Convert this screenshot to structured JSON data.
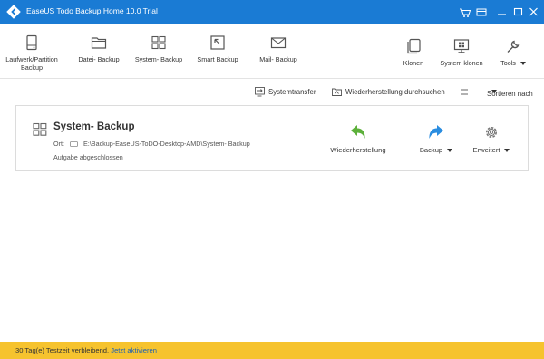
{
  "window": {
    "title": "EaseUS Todo Backup Home 10.0 Trial"
  },
  "toolbar": {
    "items": [
      {
        "label": "Laufwerk/Partition Backup",
        "icon": "disk-icon"
      },
      {
        "label": "Datei- Backup",
        "icon": "folder-icon"
      },
      {
        "label": "System- Backup",
        "icon": "windows-icon"
      },
      {
        "label": "Smart Backup",
        "icon": "smart-icon"
      },
      {
        "label": "Mail- Backup",
        "icon": "mail-icon"
      }
    ],
    "right_items": [
      {
        "label": "Klonen",
        "icon": "clone-icon"
      },
      {
        "label": "System klonen",
        "icon": "system-clone-icon"
      },
      {
        "label": "Tools",
        "icon": "wrench-icon"
      }
    ]
  },
  "actions": {
    "systemtransfer": "Systemtransfer",
    "restore_search": "Wiederherstellung durchsuchen",
    "sort": "Sortieren nach"
  },
  "task": {
    "title": "System- Backup",
    "location_label": "Ort:",
    "location_path": "E:\\Backup-EaseUS-ToDO-Desktop-AMD\\System- Backup",
    "status": "Aufgabe abgeschlossen",
    "buttons": {
      "restore": "Wiederherstellung",
      "backup": "Backup",
      "advanced": "Erweitert"
    }
  },
  "statusbar": {
    "trial_text": "30 Tag(e) Testzeit verbleibend.",
    "activate_link": "Jetzt aktivieren"
  },
  "colors": {
    "titlebar": "#1a7bd4",
    "statusbar": "#f6c32e",
    "restore_arrow": "#5cb03a",
    "backup_arrow": "#2a8de0",
    "link": "#1a5fb4"
  }
}
